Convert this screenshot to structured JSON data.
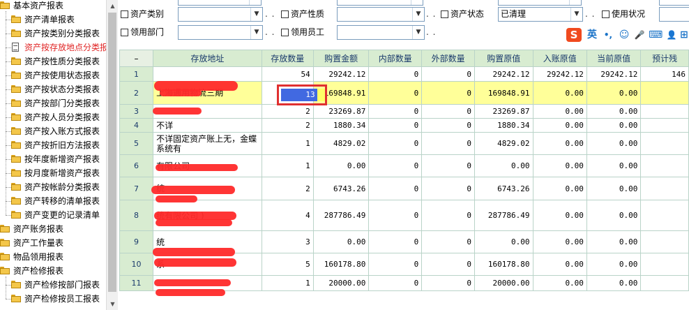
{
  "tree": {
    "items": [
      {
        "label": "基本资产报表",
        "level": 0,
        "type": "folder"
      },
      {
        "label": "资产清单报表",
        "level": 1,
        "type": "folder"
      },
      {
        "label": "资产按类别分类报表",
        "level": 1,
        "type": "folder"
      },
      {
        "label": "资产按存放地点分类报表",
        "level": 1,
        "type": "doc",
        "selected": true
      },
      {
        "label": "资产按性质分类报表",
        "level": 1,
        "type": "folder"
      },
      {
        "label": "资产按使用状态报表",
        "level": 1,
        "type": "folder"
      },
      {
        "label": "资产按状态分类报表",
        "level": 1,
        "type": "folder"
      },
      {
        "label": "资产按部门分类报表",
        "level": 1,
        "type": "folder"
      },
      {
        "label": "资产按人员分类报表",
        "level": 1,
        "type": "folder"
      },
      {
        "label": "资产按入账方式报表",
        "level": 1,
        "type": "folder"
      },
      {
        "label": "资产按折旧方法报表",
        "level": 1,
        "type": "folder"
      },
      {
        "label": "按年度新增资产报表",
        "level": 1,
        "type": "folder"
      },
      {
        "label": "按月度新增资产报表",
        "level": 1,
        "type": "folder"
      },
      {
        "label": "资产按帐龄分类报表",
        "level": 1,
        "type": "folder"
      },
      {
        "label": "资产转移的清单报表",
        "level": 1,
        "type": "folder"
      },
      {
        "label": "资产变更的记录清单",
        "level": 1,
        "type": "folder"
      },
      {
        "label": "资产账务报表",
        "level": 0,
        "type": "folder"
      },
      {
        "label": "资产工作量表",
        "level": 0,
        "type": "folder"
      },
      {
        "label": "物品领用报表",
        "level": 0,
        "type": "folder"
      },
      {
        "label": "资产检修报表",
        "level": 0,
        "type": "folder"
      },
      {
        "label": "资产检修按部门报表",
        "level": 1,
        "type": "folder"
      },
      {
        "label": "资产检修按员工报表",
        "level": 1,
        "type": "folder"
      }
    ]
  },
  "filters": {
    "row1": [
      {
        "label": "资产类别",
        "value": ""
      },
      {
        "label": "资产性质",
        "value": ""
      },
      {
        "label": "资产状态",
        "value": "已清理"
      },
      {
        "label": "使用状况",
        "value": ""
      }
    ],
    "row2": [
      {
        "label": "领用部门",
        "value": ""
      },
      {
        "label": "领用员工",
        "value": ""
      }
    ],
    "dots": ". ."
  },
  "ime": {
    "logo": "S",
    "lang": "英",
    "punct": "•,",
    "emoji": "☺",
    "mic": "🎤",
    "keyboard": "⌨",
    "user": "👤",
    "apps": "⊞"
  },
  "grid": {
    "corner": "–",
    "headers": [
      "存放地址",
      "存放数量",
      "购置金额",
      "内部数量",
      "外部数量",
      "购置原值",
      "入账原值",
      "当前原值",
      "预计残"
    ],
    "rows": [
      {
        "no": "1",
        "addr": "",
        "qty": "54",
        "amount": "29242.12",
        "internal": "0",
        "external": "0",
        "orig": "29242.12",
        "entry": "29242.12",
        "current": "29242.12",
        "residual": "146"
      },
      {
        "no": "2",
        "addr": "上海通用物流三期",
        "qty": "13",
        "amount": "169848.91",
        "internal": "0",
        "external": "0",
        "orig": "169848.91",
        "entry": "0.00",
        "current": "0.00",
        "residual": "",
        "highlight": true
      },
      {
        "no": "3",
        "addr": "",
        "qty": "2",
        "amount": "23269.87",
        "internal": "0",
        "external": "0",
        "orig": "23269.87",
        "entry": "0.00",
        "current": "0.00",
        "residual": ""
      },
      {
        "no": "4",
        "addr": "不详",
        "qty": "2",
        "amount": "1880.34",
        "internal": "0",
        "external": "0",
        "orig": "1880.34",
        "entry": "0.00",
        "current": "0.00",
        "residual": ""
      },
      {
        "no": "5",
        "addr": "不详固定资产账上无，金蝶系统有",
        "qty": "1",
        "amount": "4829.02",
        "internal": "0",
        "external": "0",
        "orig": "4829.02",
        "entry": "0.00",
        "current": "0.00",
        "residual": ""
      },
      {
        "no": "6",
        "addr": "有限公司",
        "qty": "1",
        "amount": "0.00",
        "internal": "0",
        "external": "0",
        "orig": "0.00",
        "entry": "0.00",
        "current": "0.00",
        "residual": ""
      },
      {
        "no": "7",
        "addr": "统",
        "qty": "2",
        "amount": "6743.26",
        "internal": "0",
        "external": "0",
        "orig": "6743.26",
        "entry": "0.00",
        "current": "0.00",
        "residual": ""
      },
      {
        "no": "8",
        "addr": "统有限公司 )",
        "qty": "4",
        "amount": "287786.49",
        "internal": "0",
        "external": "0",
        "orig": "287786.49",
        "entry": "0.00",
        "current": "0.00",
        "residual": ""
      },
      {
        "no": "9",
        "addr": "统",
        "qty": "3",
        "amount": "0.00",
        "internal": "0",
        "external": "0",
        "orig": "0.00",
        "entry": "0.00",
        "current": "0.00",
        "residual": ""
      },
      {
        "no": "10",
        "addr": "系",
        "qty": "5",
        "amount": "160178.80",
        "internal": "0",
        "external": "0",
        "orig": "160178.80",
        "entry": "0.00",
        "current": "0.00",
        "residual": ""
      },
      {
        "no": "11",
        "addr": "",
        "qty": "1",
        "amount": "20000.00",
        "internal": "0",
        "external": "0",
        "orig": "20000.00",
        "entry": "0.00",
        "current": "0.00",
        "residual": ""
      }
    ]
  },
  "colors": {
    "header_bg": "#d8ecd1",
    "highlight_row": "#ffff99",
    "selected_cell": "#4169e1",
    "annotation": "#e03030"
  }
}
